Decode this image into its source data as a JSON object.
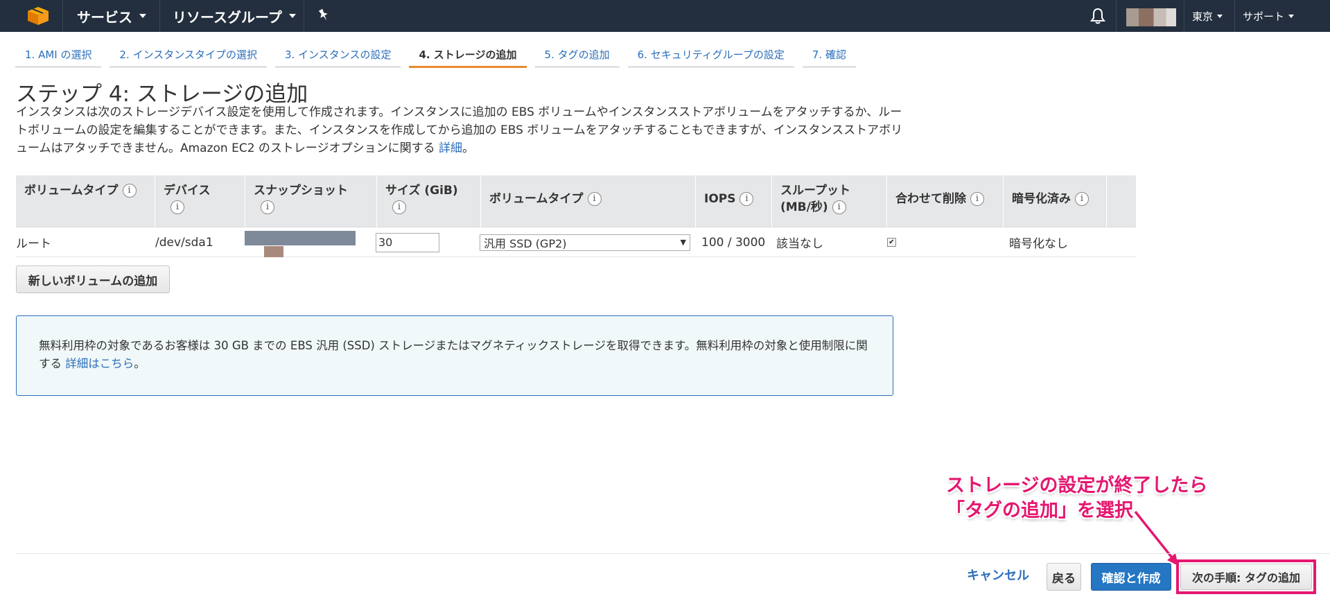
{
  "nav": {
    "services": "サービス",
    "resource_groups": "リソースグループ",
    "region": "東京",
    "support": "サポート"
  },
  "tabs": [
    {
      "label": "1. AMI の選択",
      "active": false
    },
    {
      "label": "2. インスタンスタイプの選択",
      "active": false
    },
    {
      "label": "3. インスタンスの設定",
      "active": false
    },
    {
      "label": "4. ストレージの追加",
      "active": true
    },
    {
      "label": "5. タグの追加",
      "active": false
    },
    {
      "label": "6. セキュリティグループの設定",
      "active": false
    },
    {
      "label": "7. 確認",
      "active": false
    }
  ],
  "page": {
    "title": "ステップ 4: ストレージの追加",
    "description": "インスタンスは次のストレージデバイス設定を使用して作成されます。インスタンスに追加の EBS ボリュームやインスタンスストアボリュームをアタッチするか、ルートボリュームの設定を編集することができます。また、インスタンスを作成してから追加の EBS ボリュームをアタッチすることもできますが、インスタンスストアボリュームはアタッチできません。Amazon EC2 のストレージオプションに関する",
    "description_link": "詳細",
    "description_end": "。"
  },
  "table": {
    "headers": {
      "volume_type": "ボリュームタイプ",
      "device": "デバイス",
      "snapshot": "スナップショット",
      "size": "サイズ (GiB)",
      "volume_type2": "ボリュームタイプ",
      "iops": "IOPS",
      "throughput": "スループット",
      "throughput_unit": "(MB/秒)",
      "delete": "合わせて削除",
      "encrypted": "暗号化済み"
    },
    "info_glyph": "i",
    "row": {
      "volume_type": "ルート",
      "device": "/dev/sda1",
      "size": "30",
      "volume_select": "汎用 SSD (GP2)",
      "iops": "100 / 3000",
      "throughput": "該当なし",
      "delete_checked": true,
      "encrypted": "暗号化なし"
    }
  },
  "add_volume_button": "新しいボリュームの追加",
  "notice": {
    "text": "無料利用枠の対象であるお客様は 30 GB までの EBS 汎用 (SSD) ストレージまたはマグネティックストレージを取得できます。無料利用枠の対象と使用制限に関する",
    "link": "詳細はこちら",
    "end": "。"
  },
  "footer": {
    "cancel": "キャンセル",
    "back": "戻る",
    "review": "確認と作成",
    "next": "次の手順: タグの追加"
  },
  "annotation": {
    "line1": "ストレージの設定が終了したら",
    "line2": "「タグの追加」を選択"
  },
  "colors": {
    "nav_bg": "#232f3e",
    "link": "#2a6ebb",
    "active_tab": "#e88a2e",
    "primary": "#2576c3",
    "highlight": "#e5176f"
  }
}
